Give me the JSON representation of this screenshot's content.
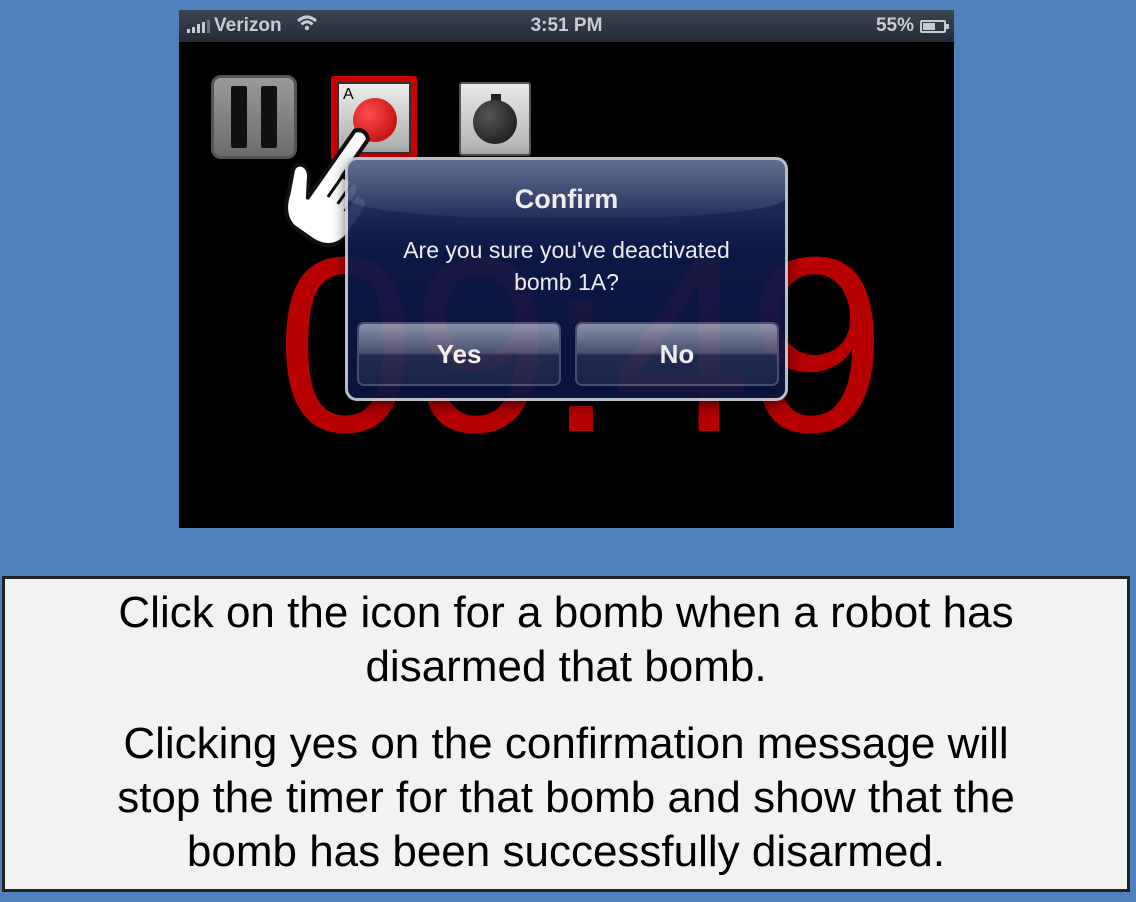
{
  "status_bar": {
    "carrier": "Verizon",
    "time": "3:51 PM",
    "battery": "55%",
    "battery_level": 0.55
  },
  "timer": {
    "display": "09:49"
  },
  "controls": {
    "pause_icon": "pause-icon",
    "bomb_1a_label": "A",
    "bomb_1a_icon": "bomb-icon",
    "bomb_2_icon": "bomb-icon",
    "pointer_icon": "hand-pointer-icon"
  },
  "dialog": {
    "title": "Confirm",
    "message_line1": "Are you sure you've deactivated",
    "message_line2": "bomb 1A?",
    "yes_label": "Yes",
    "no_label": "No"
  },
  "caption": {
    "para1_line1": "Click on the icon for a bomb when a robot has",
    "para1_line2": "disarmed that bomb.",
    "para2_line1": "Clicking yes on the confirmation message will",
    "para2_line2": "stop the timer for that bomb and show that the",
    "para2_line3": "bomb has been successfully disarmed."
  },
  "colors": {
    "background": "#4f81bd",
    "timer": "#b70000",
    "dialog": "#0d1a4a",
    "bomb_active": "#cc0000"
  }
}
